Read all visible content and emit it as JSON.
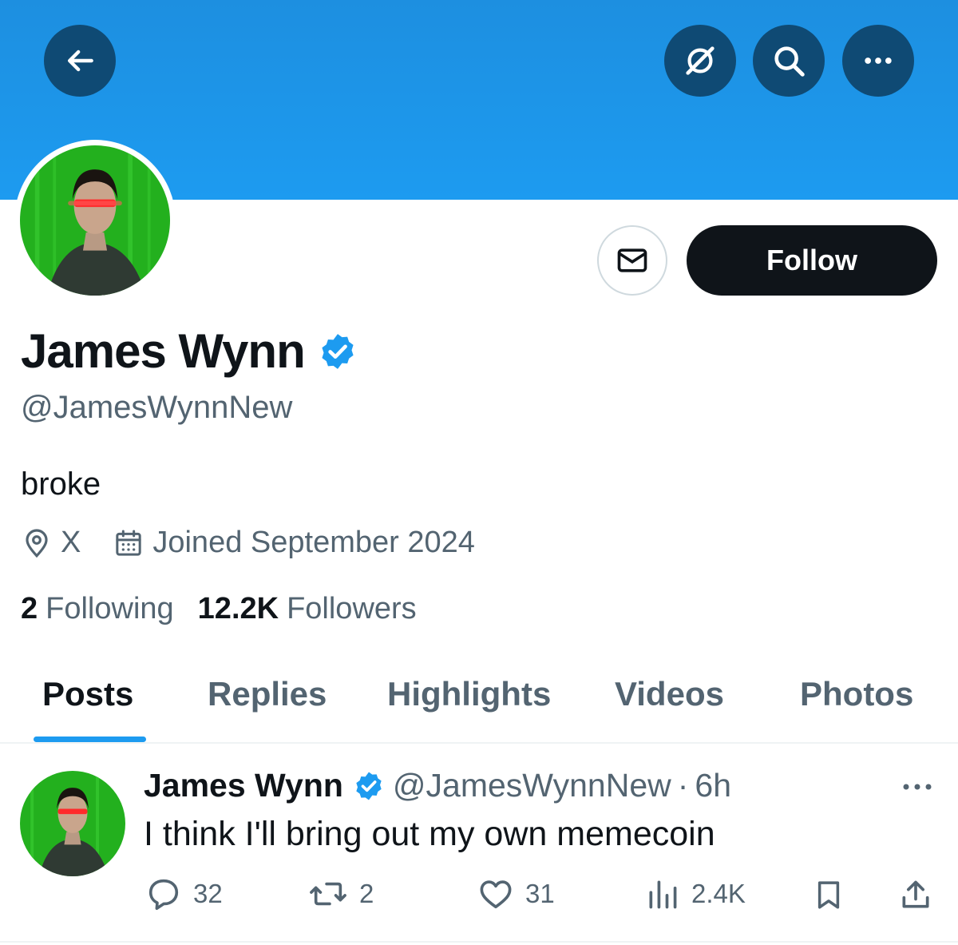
{
  "header": {
    "back": "back-arrow-icon",
    "grok": "grok-icon",
    "search": "search-icon",
    "more": "more-icon",
    "banner_color": "#1d9bf0"
  },
  "profile": {
    "display_name": "James Wynn",
    "handle": "@JamesWynnNew",
    "bio": "broke",
    "location": "X",
    "joined": "Joined September 2024",
    "following_count": "2",
    "following_label": "Following",
    "followers_count": "12.2K",
    "followers_label": "Followers",
    "follow_label": "Follow"
  },
  "tabs": [
    {
      "label": "Posts",
      "active": true
    },
    {
      "label": "Replies"
    },
    {
      "label": "Highlights"
    },
    {
      "label": "Videos"
    },
    {
      "label": "Photos"
    }
  ],
  "tweet": {
    "name": "James Wynn",
    "handle": "@JamesWynnNew",
    "separator": "·",
    "time": "6h",
    "text": "I think I'll bring out my own memecoin",
    "replies": "32",
    "reposts": "2",
    "likes": "31",
    "views": "2.4K"
  },
  "colors": {
    "accent": "#1d9bf0",
    "text": "#0f1419",
    "muted": "#536471"
  }
}
